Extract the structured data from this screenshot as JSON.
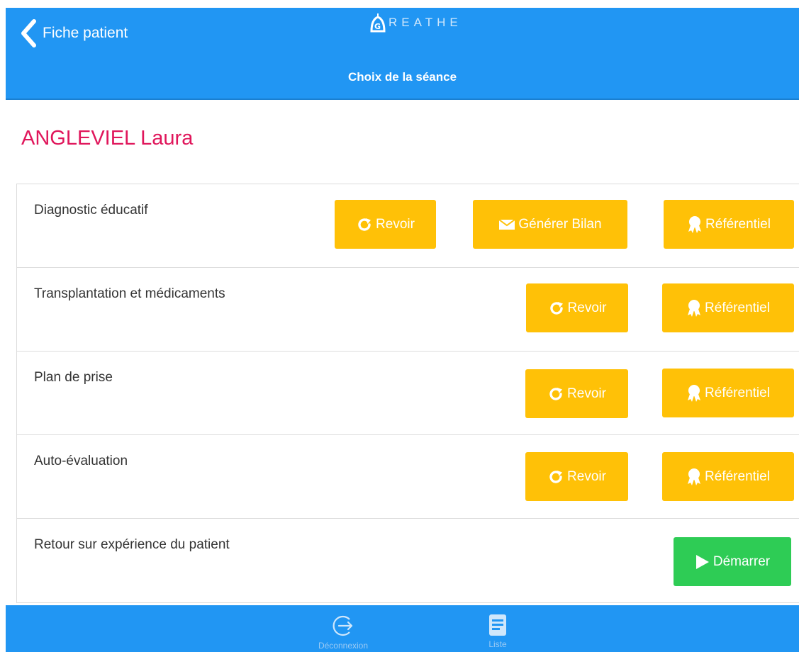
{
  "header": {
    "back_label": "Fiche patient",
    "logo_text": "REATHE",
    "title": "Choix de la séance"
  },
  "patient": {
    "name": "ANGLEVIEL Laura"
  },
  "sessions": [
    {
      "label": "Diagnostic éducatif",
      "buttons": [
        "Revoir",
        "Générer Bilan",
        "Référentiel"
      ]
    },
    {
      "label": "Transplantation et médicaments",
      "buttons": [
        "Revoir",
        "Référentiel"
      ]
    },
    {
      "label": "Plan de prise",
      "buttons": [
        "Revoir",
        "Référentiel"
      ]
    },
    {
      "label": "Auto-évaluation",
      "buttons": [
        "Revoir",
        "Référentiel"
      ]
    },
    {
      "label": "Retour sur expérience du patient",
      "buttons": [
        "Démarrer"
      ]
    }
  ],
  "bottom_nav": [
    {
      "label": "Déconnexion",
      "icon": "logout-icon"
    },
    {
      "label": "Liste",
      "icon": "list-icon"
    }
  ],
  "colors": {
    "primary": "#2196f3",
    "accent_name": "#e0165b",
    "button_yellow": "#ffc107",
    "button_green": "#2ecc55"
  }
}
